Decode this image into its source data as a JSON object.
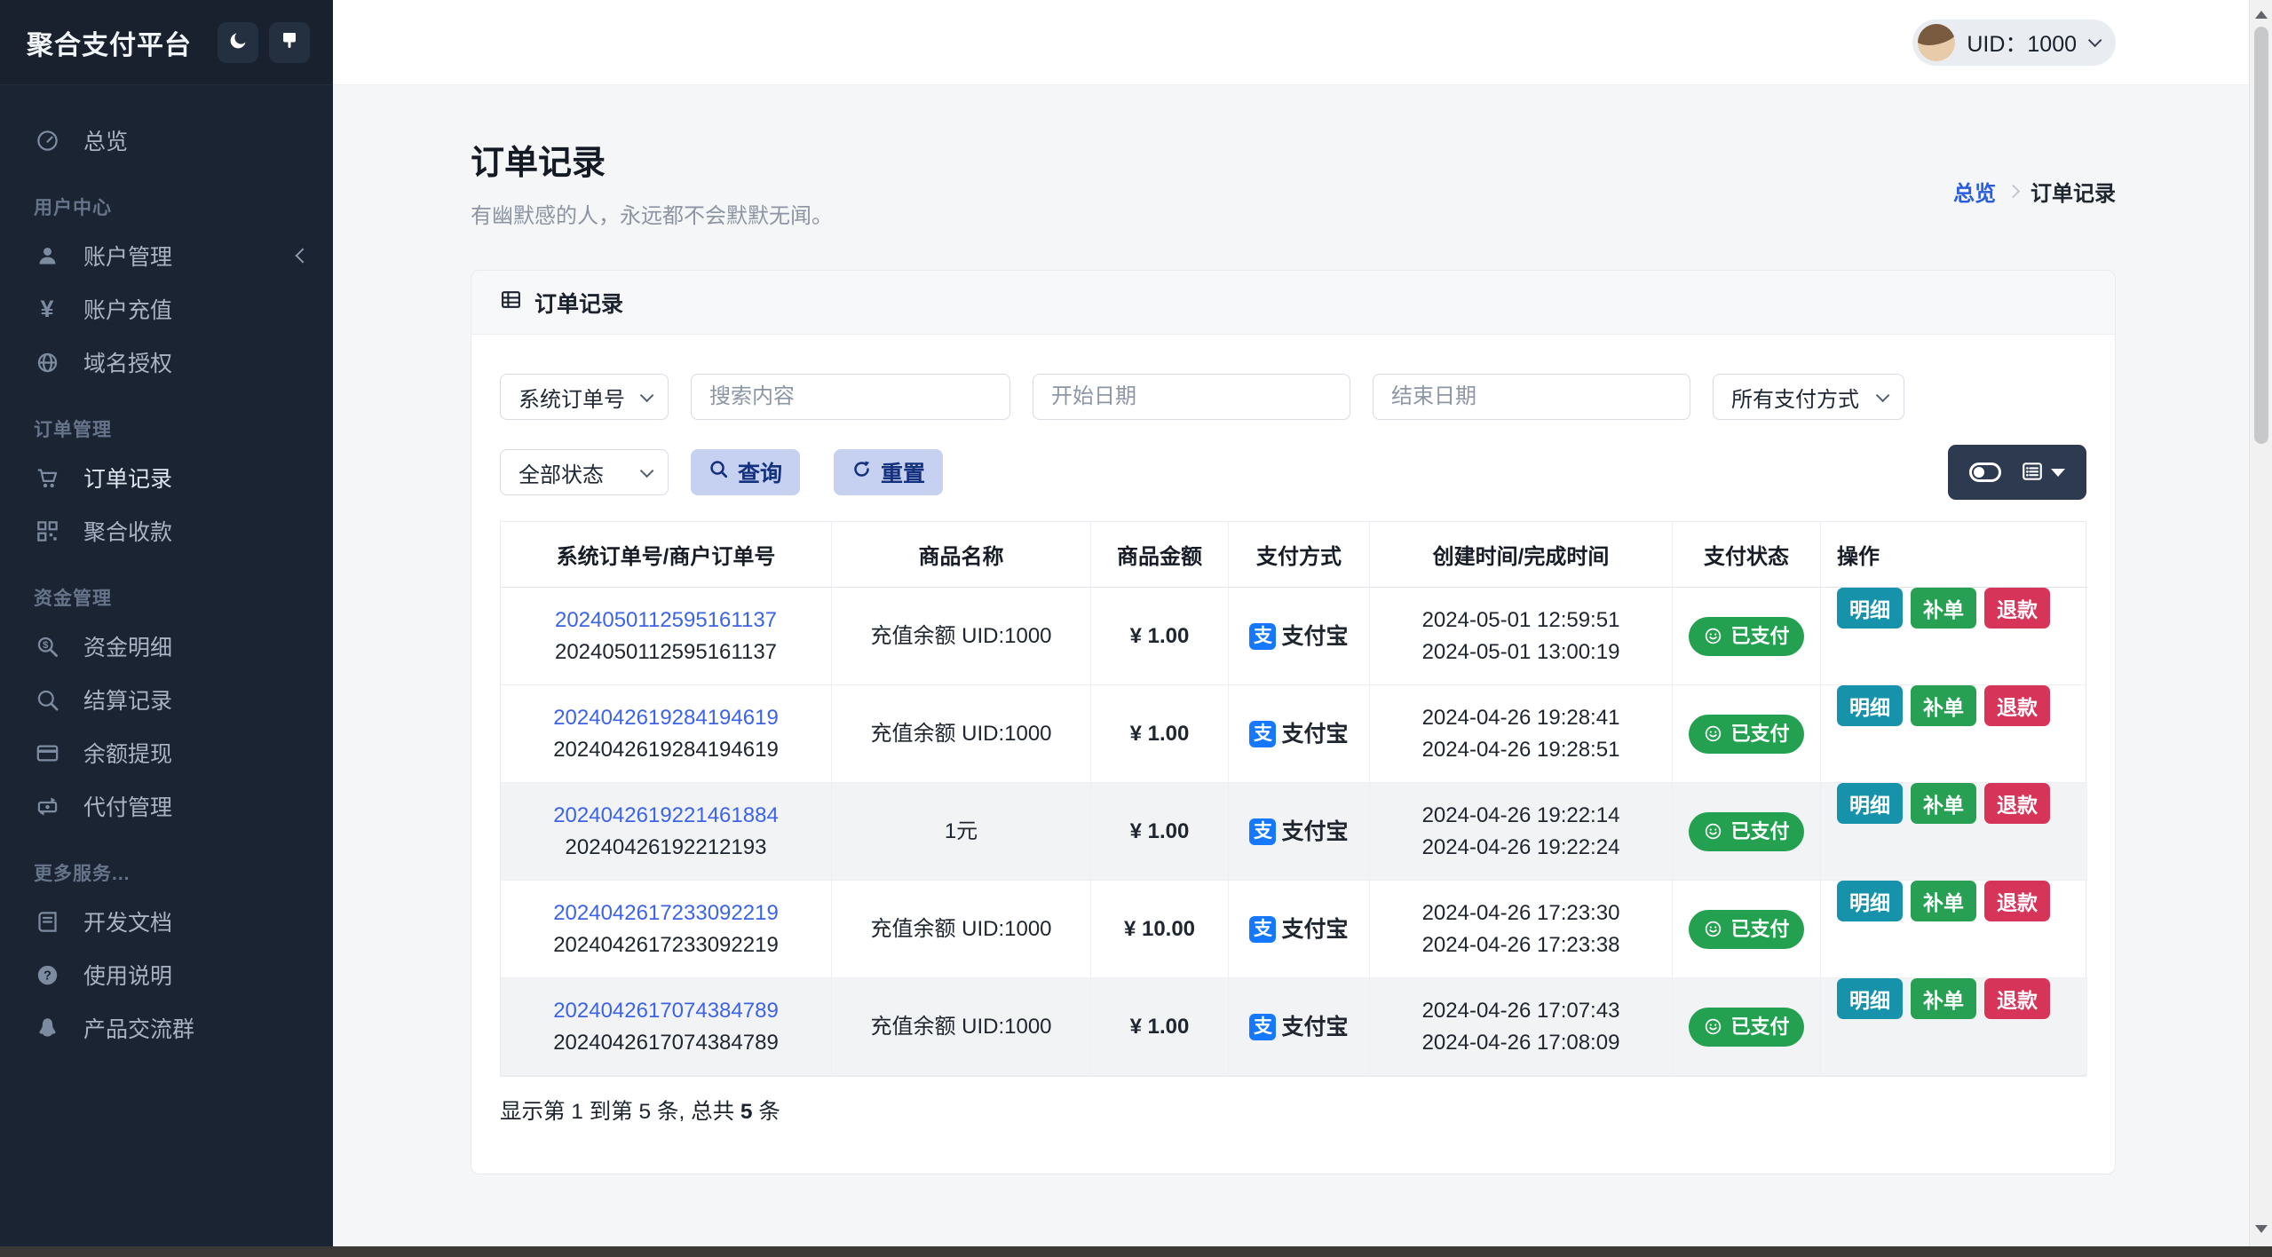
{
  "app": {
    "title": "聚合支付平台"
  },
  "topbar": {
    "uid_label": "UID：1000"
  },
  "sidebar": {
    "sections": [
      {
        "label": "",
        "items": [
          {
            "icon": "dashboard",
            "label": "总览"
          }
        ]
      },
      {
        "label": "用户中心",
        "items": [
          {
            "icon": "user",
            "label": "账户管理"
          },
          {
            "icon": "yen",
            "label": "账户充值"
          },
          {
            "icon": "browser",
            "label": "域名授权"
          }
        ]
      },
      {
        "label": "订单管理",
        "items": [
          {
            "icon": "cart",
            "label": "订单记录"
          },
          {
            "icon": "qrcode",
            "label": "聚合收款"
          }
        ]
      },
      {
        "label": "资金管理",
        "items": [
          {
            "icon": "search-dollar",
            "label": "资金明细"
          },
          {
            "icon": "search",
            "label": "结算记录"
          },
          {
            "icon": "credit-card",
            "label": "余额提现"
          },
          {
            "icon": "money-transfer",
            "label": "代付管理"
          }
        ]
      },
      {
        "label": "更多服务...",
        "items": [
          {
            "icon": "book",
            "label": "开发文档"
          },
          {
            "icon": "question",
            "label": "使用说明"
          },
          {
            "icon": "qq",
            "label": "产品交流群"
          }
        ]
      }
    ]
  },
  "page": {
    "title": "订单记录",
    "subtitle": "有幽默感的人，永远都不会默默无闻。",
    "breadcrumb": {
      "root": "总览",
      "current": "订单记录"
    }
  },
  "card": {
    "header": "订单记录"
  },
  "filters": {
    "search_type": "系统订单号",
    "search_placeholder": "搜索内容",
    "start_date_placeholder": "开始日期",
    "end_date_placeholder": "结束日期",
    "pay_method": "所有支付方式",
    "status": "全部状态",
    "query_label": "查询",
    "reset_label": "重置"
  },
  "table": {
    "headers": [
      "系统订单号/商户订单号",
      "商品名称",
      "商品金额",
      "支付方式",
      "创建时间/完成时间",
      "支付状态",
      "操作"
    ],
    "actions": [
      "明细",
      "补单",
      "退款"
    ],
    "status_paid": "已支付",
    "pay_method": "支付宝",
    "alipay_glyph": "支",
    "rows": [
      {
        "sys_no": "2024050112595161137",
        "merchant_no": "2024050112595161137",
        "product": "充值余额 UID:1000",
        "amount": "¥ 1.00",
        "created": "2024-05-01 12:59:51",
        "completed": "2024-05-01 13:00:19"
      },
      {
        "sys_no": "2024042619284194619",
        "merchant_no": "2024042619284194619",
        "product": "充值余额 UID:1000",
        "amount": "¥ 1.00",
        "created": "2024-04-26 19:28:41",
        "completed": "2024-04-26 19:28:51"
      },
      {
        "sys_no": "2024042619221461884",
        "merchant_no": "20240426192212193",
        "product": "1元",
        "amount": "¥ 1.00",
        "created": "2024-04-26 19:22:14",
        "completed": "2024-04-26 19:22:24"
      },
      {
        "sys_no": "2024042617233092219",
        "merchant_no": "2024042617233092219",
        "product": "充值余额 UID:1000",
        "amount": "¥ 10.00",
        "created": "2024-04-26 17:23:30",
        "completed": "2024-04-26 17:23:38"
      },
      {
        "sys_no": "2024042617074384789",
        "merchant_no": "2024042617074384789",
        "product": "充值余额 UID:1000",
        "amount": "¥ 1.00",
        "created": "2024-04-26 17:07:43",
        "completed": "2024-04-26 17:08:09"
      }
    ],
    "footer": {
      "prefix": "显示第 1 到第 5 条, 总共 ",
      "total": "5",
      "suffix": " 条"
    }
  },
  "colors": {
    "sidebar_bg": "#1b2433",
    "alipay_blue": "#1677ff",
    "link_blue": "#3d63e8",
    "success_green": "#23a050",
    "info_teal": "#1792ab",
    "danger_red": "#d63458",
    "primary_soft": "#c6d0f1",
    "dark_toolbar": "#2d3a4f"
  }
}
